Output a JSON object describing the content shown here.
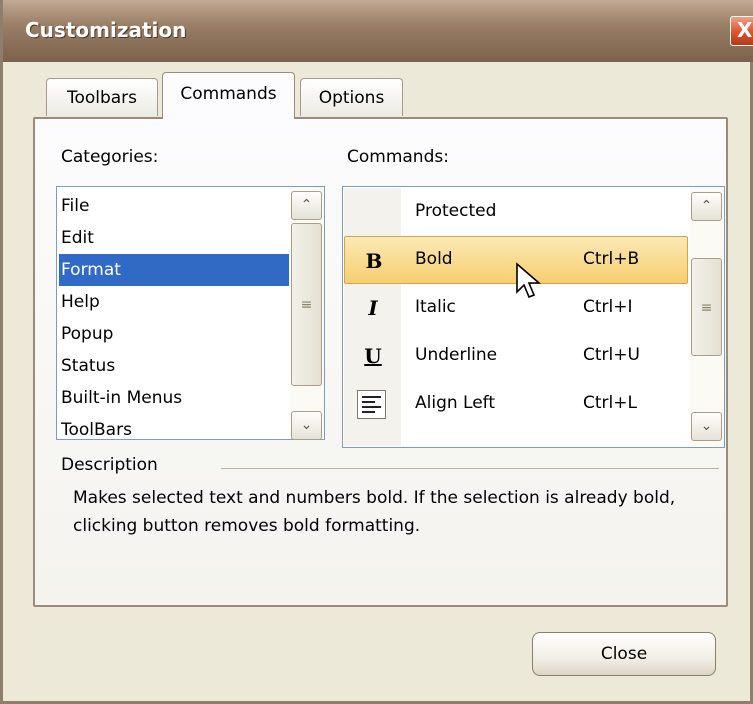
{
  "window": {
    "title": "Customization",
    "close_glyph": "X"
  },
  "tabs": [
    {
      "label": "Toolbars",
      "active": false
    },
    {
      "label": "Commands",
      "active": true
    },
    {
      "label": "Options",
      "active": false
    }
  ],
  "categories": {
    "label": "Categories:",
    "items": [
      "File",
      "Edit",
      "Format",
      "Help",
      "Popup",
      "Status",
      "Built-in Menus",
      "ToolBars"
    ],
    "selected": "Format"
  },
  "commands": {
    "label": "Commands:",
    "items": [
      {
        "icon": "",
        "name": "Protected",
        "shortcut": ""
      },
      {
        "icon": "B",
        "name": "Bold",
        "shortcut": "Ctrl+B",
        "highlighted": true
      },
      {
        "icon": "I",
        "name": "Italic",
        "shortcut": "Ctrl+I"
      },
      {
        "icon": "U",
        "name": "Underline",
        "shortcut": "Ctrl+U"
      },
      {
        "icon": "align-left-icon",
        "name": "Align Left",
        "shortcut": "Ctrl+L"
      }
    ]
  },
  "description": {
    "label": "Description",
    "text": "Makes selected text and numbers bold. If the selection is already bold, clicking button removes bold formatting."
  },
  "buttons": {
    "close_label": "Close"
  },
  "scroll_glyphs": {
    "up": "⌃",
    "down": "⌄",
    "grip": "≡"
  }
}
